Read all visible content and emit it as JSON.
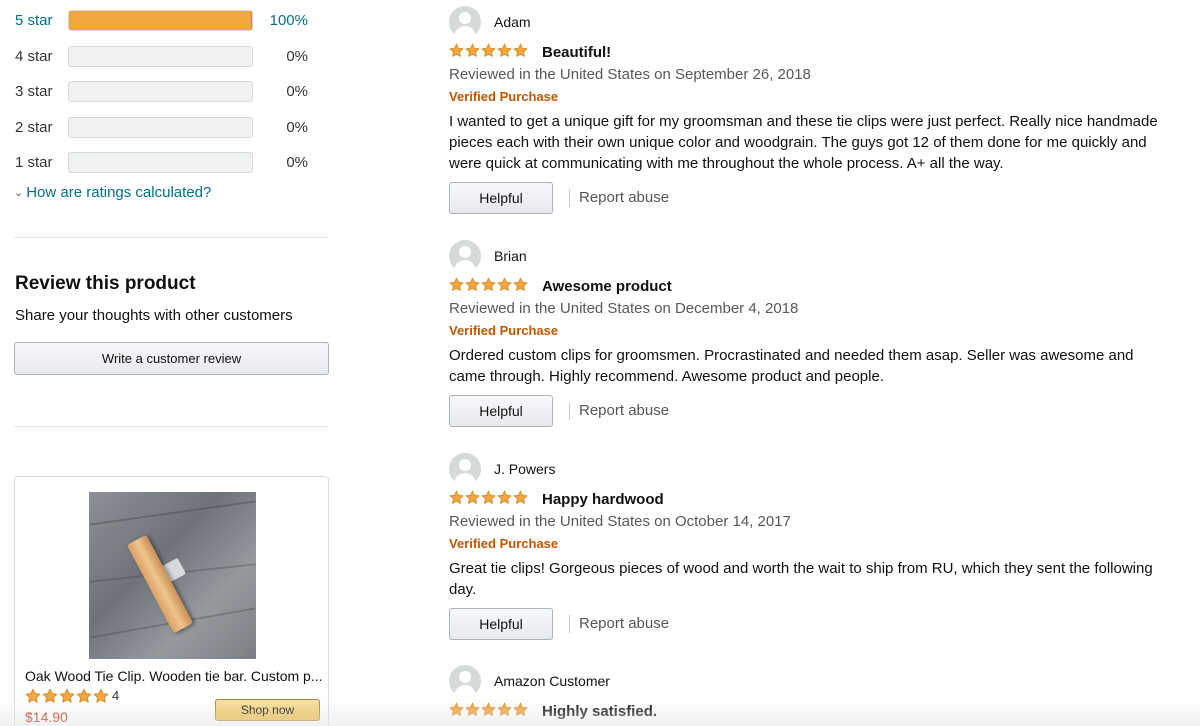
{
  "histogram": [
    {
      "label": "5 star",
      "percent_text": "100%",
      "percent": 100
    },
    {
      "label": "4 star",
      "percent_text": "0%",
      "percent": 0
    },
    {
      "label": "3 star",
      "percent_text": "0%",
      "percent": 0
    },
    {
      "label": "2 star",
      "percent_text": "0%",
      "percent": 0
    },
    {
      "label": "1 star",
      "percent_text": "0%",
      "percent": 0
    }
  ],
  "ratings_help_link": "How are ratings calculated?",
  "review_product": {
    "title": "Review this product",
    "subtitle": "Share your thoughts with other customers",
    "button_label": "Write a customer review"
  },
  "sponsored": {
    "title": "Oak Wood Tie Clip. Wooden tie bar. Custom p...",
    "rating": 5,
    "rating_count": "4",
    "price": "$14.90",
    "button_label": "Shop now"
  },
  "reviews": [
    {
      "author": "Adam",
      "rating": 5,
      "title": "Beautiful!",
      "date": "Reviewed in the United States on September 26, 2018",
      "verified": "Verified Purchase",
      "body": "I wanted to get a unique gift for my groomsman and these tie clips were just perfect. Really nice handmade pieces each with their own unique color and woodgrain. The guys got 12 of them done for me quickly and were quick at communicating with me throughout the whole process. A+ all the way.",
      "helpful_label": "Helpful",
      "report_label": "Report abuse"
    },
    {
      "author": "Brian",
      "rating": 5,
      "title": "Awesome product",
      "date": "Reviewed in the United States on December 4, 2018",
      "verified": "Verified Purchase",
      "body": "Ordered custom clips for groomsmen. Procrastinated and needed them asap. Seller was awesome and came through. Highly recommend. Awesome product and people.",
      "helpful_label": "Helpful",
      "report_label": "Report abuse"
    },
    {
      "author": "J. Powers",
      "rating": 5,
      "title": "Happy hardwood",
      "date": "Reviewed in the United States on October 14, 2017",
      "verified": "Verified Purchase",
      "body": "Great tie clips! Gorgeous pieces of wood and worth the wait to ship from RU, which they sent the following day.",
      "helpful_label": "Helpful",
      "report_label": "Report abuse"
    },
    {
      "author": "Amazon Customer",
      "rating": 5,
      "title": "Highly satisfied."
    }
  ],
  "colors": {
    "star_fill": "#f0a742",
    "star_stroke": "#d58a1f",
    "link": "#007185",
    "verified": "#c45500",
    "price": "#b12704"
  },
  "icons": {
    "star": "star-icon",
    "avatar": "user-avatar-icon",
    "chevron": "chevron-down-icon"
  }
}
